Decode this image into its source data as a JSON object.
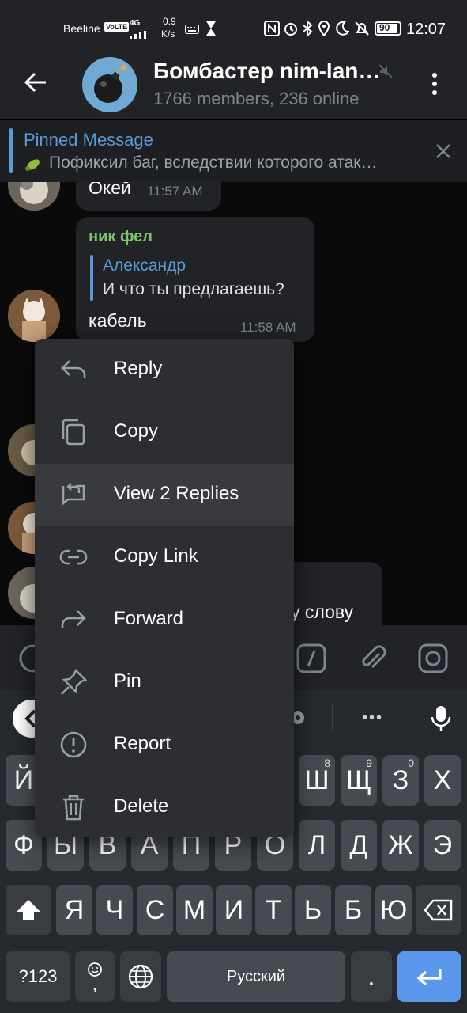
{
  "status_bar": {
    "carrier": "Beeline",
    "volte": "VoLTE",
    "network": "4G",
    "speed_value": "0.9",
    "speed_unit": "K/s",
    "battery": "90",
    "time": "12:07"
  },
  "header": {
    "title": "Бомбастер nim-lan…",
    "subtitle": "1766 members, 236 online"
  },
  "pinned": {
    "label": "Pinned Message",
    "text": "Пофиксил баг, вследствии которого атак…"
  },
  "messages": [
    {
      "text": "Окей",
      "time": "11:57 AM"
    },
    {
      "sender": "ник фел",
      "reply_to_name": "Александр",
      "reply_to_text": "И что ты предлагаешь?",
      "text": "кабель",
      "time": "11:58 AM"
    },
    {
      "text": "у слову"
    }
  ],
  "context_menu": {
    "items": [
      {
        "label": "Reply",
        "icon": "reply-icon"
      },
      {
        "label": "Copy",
        "icon": "copy-icon"
      },
      {
        "label": "View 2 Replies",
        "icon": "view-replies-icon",
        "highlighted": true
      },
      {
        "label": "Copy Link",
        "icon": "link-icon"
      },
      {
        "label": "Forward",
        "icon": "forward-icon"
      },
      {
        "label": "Pin",
        "icon": "pin-icon"
      },
      {
        "label": "Report",
        "icon": "report-icon"
      },
      {
        "label": "Delete",
        "icon": "delete-icon"
      }
    ]
  },
  "keyboard": {
    "suggestions_more": "•••",
    "row1": [
      {
        "key": "Й",
        "hint": ""
      },
      {
        "key": "Ш",
        "hint": "8"
      },
      {
        "key": "Щ",
        "hint": "9"
      },
      {
        "key": "З",
        "hint": "0"
      },
      {
        "key": "Х",
        "hint": ""
      }
    ],
    "row2": [
      "Ф",
      "Ы",
      "В",
      "А",
      "П",
      "Р",
      "О",
      "Л",
      "Д",
      "Ж",
      "Э"
    ],
    "row3": [
      "Я",
      "Ч",
      "С",
      "М",
      "И",
      "Т",
      "Ь",
      "Б",
      "Ю"
    ],
    "symbols_key": "?123",
    "comma": ",",
    "space_label": "Русский",
    "period": "."
  },
  "colors": {
    "accent_blue": "#5b9ad6",
    "sender_green": "#7dc46a",
    "enter_key": "#5a97ea"
  }
}
